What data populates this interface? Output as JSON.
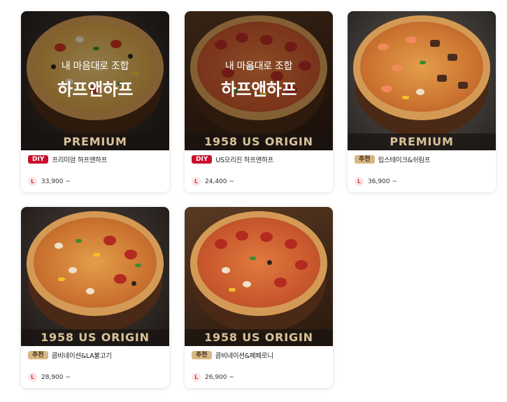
{
  "products": [
    {
      "overlay_sub": "내 마음대로 조합",
      "overlay_main": "하프앤하프",
      "band": "PREMIUM",
      "badge": "DIY",
      "name": "프리미엄 하프앤하프",
      "size": "L",
      "price": "33,900 ~"
    },
    {
      "overlay_sub": "내 마음대로 조합",
      "overlay_main": "하프앤하프",
      "band": "1958 US ORIGIN",
      "badge": "DIY",
      "name": "US오리진 하프앤하프",
      "size": "L",
      "price": "24,400 ~"
    },
    {
      "band": "PREMIUM",
      "badge": "추천",
      "name": "립스테이크&쉬림프",
      "size": "L",
      "price": "36,900 ~"
    },
    {
      "band": "1958 US ORIGIN",
      "badge": "추천",
      "name": "콤비네이션&LA불고기",
      "size": "L",
      "price": "28,900 ~"
    },
    {
      "band": "1958 US ORIGIN",
      "badge": "추천",
      "name": "콤비네이션&페페로니",
      "size": "L",
      "price": "26,900 ~"
    }
  ],
  "colors": {
    "diy_badge": "#c8102e",
    "recommend_badge": "#d8b785",
    "band_text": "#d9c299",
    "size_badge": "#d6333e"
  }
}
